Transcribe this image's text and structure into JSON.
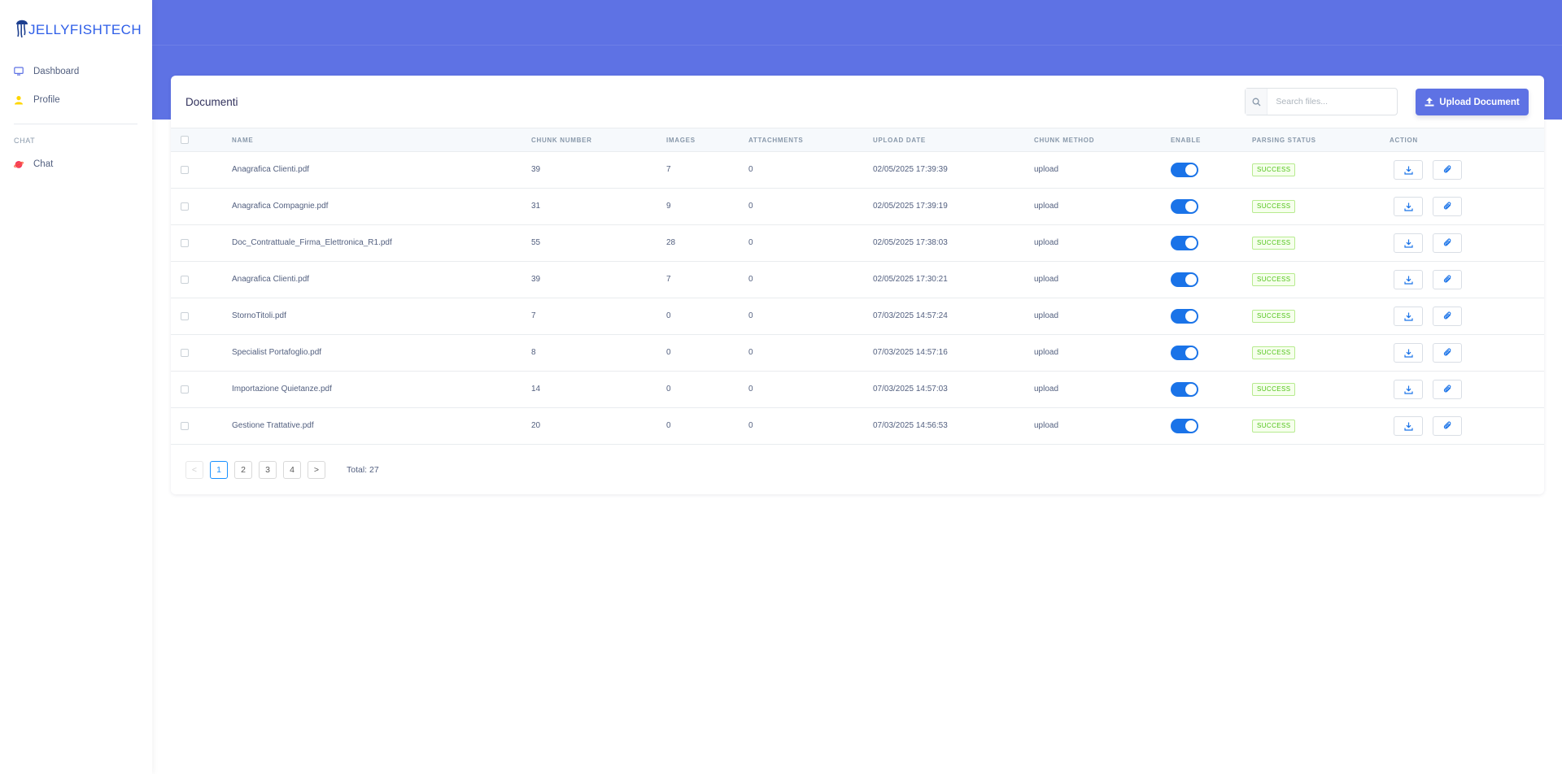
{
  "brand": {
    "name": "JELLYFISHTECH"
  },
  "sidebar": {
    "items": [
      {
        "label": "Dashboard",
        "icon": "monitor-icon"
      },
      {
        "label": "Profile",
        "icon": "user-icon"
      }
    ],
    "section_heading": "CHAT",
    "chat_item": {
      "label": "Chat",
      "icon": "planet-icon"
    }
  },
  "card": {
    "title": "Documenti",
    "search_placeholder": "Search files...",
    "upload_label": "Upload Document"
  },
  "table": {
    "columns": [
      "NAME",
      "CHUNK NUMBER",
      "IMAGES",
      "ATTACHMENTS",
      "UPLOAD DATE",
      "CHUNK METHOD",
      "ENABLE",
      "PARSING STATUS",
      "ACTION"
    ],
    "rows": [
      {
        "name": "Anagrafica Clienti.pdf",
        "chunks": "39",
        "images": "7",
        "attachments": "0",
        "date": "02/05/2025 17:39:39",
        "method": "upload",
        "enabled": true,
        "status": "SUCCESS"
      },
      {
        "name": "Anagrafica Compagnie.pdf",
        "chunks": "31",
        "images": "9",
        "attachments": "0",
        "date": "02/05/2025 17:39:19",
        "method": "upload",
        "enabled": true,
        "status": "SUCCESS"
      },
      {
        "name": "Doc_Contrattuale_Firma_Elettronica_R1.pdf",
        "chunks": "55",
        "images": "28",
        "attachments": "0",
        "date": "02/05/2025 17:38:03",
        "method": "upload",
        "enabled": true,
        "status": "SUCCESS"
      },
      {
        "name": "Anagrafica Clienti.pdf",
        "chunks": "39",
        "images": "7",
        "attachments": "0",
        "date": "02/05/2025 17:30:21",
        "method": "upload",
        "enabled": true,
        "status": "SUCCESS"
      },
      {
        "name": "StornoTitoli.pdf",
        "chunks": "7",
        "images": "0",
        "attachments": "0",
        "date": "07/03/2025 14:57:24",
        "method": "upload",
        "enabled": true,
        "status": "SUCCESS"
      },
      {
        "name": "Specialist Portafoglio.pdf",
        "chunks": "8",
        "images": "0",
        "attachments": "0",
        "date": "07/03/2025 14:57:16",
        "method": "upload",
        "enabled": true,
        "status": "SUCCESS"
      },
      {
        "name": "Importazione Quietanze.pdf",
        "chunks": "14",
        "images": "0",
        "attachments": "0",
        "date": "07/03/2025 14:57:03",
        "method": "upload",
        "enabled": true,
        "status": "SUCCESS"
      },
      {
        "name": "Gestione Trattative.pdf",
        "chunks": "20",
        "images": "0",
        "attachments": "0",
        "date": "07/03/2025 14:56:53",
        "method": "upload",
        "enabled": true,
        "status": "SUCCESS"
      }
    ]
  },
  "pagination": {
    "prev": "<",
    "next": ">",
    "pages": [
      "1",
      "2",
      "3",
      "4"
    ],
    "current": "1",
    "total_label": "Total: 27"
  },
  "colors": {
    "accent": "#5e72e4",
    "toggle_on": "#1a73e8",
    "success": "#52c41a",
    "brand": "#2e5ee8"
  }
}
